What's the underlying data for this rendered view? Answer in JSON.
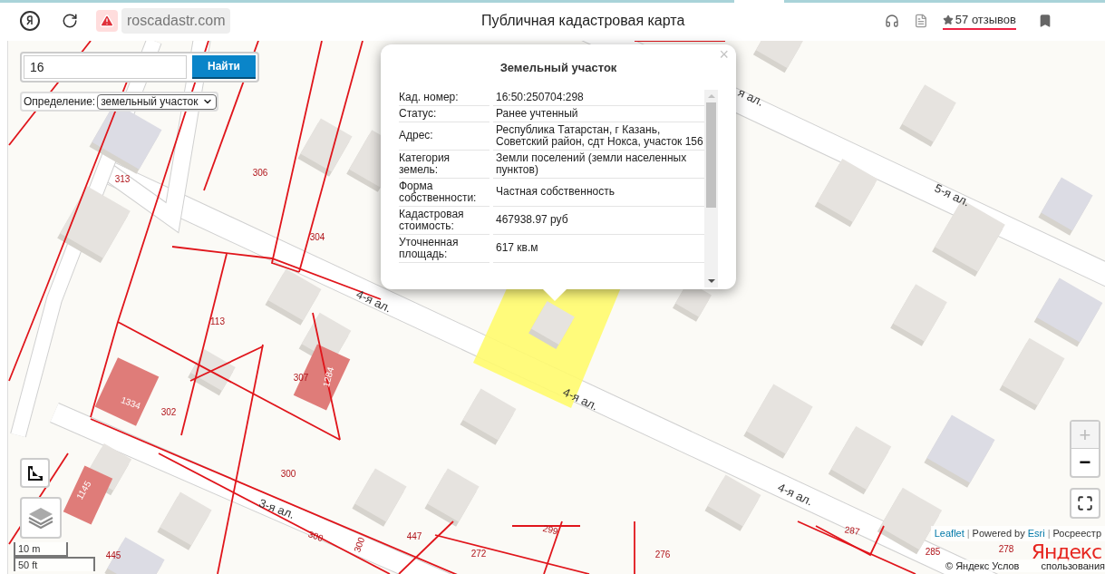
{
  "browser": {
    "address": "roscadastr.com",
    "page_title": "Публичная кадастровая карта",
    "reviews": "57 отзывов"
  },
  "search": {
    "value": "16",
    "button": "Найти"
  },
  "definition": {
    "label": "Определение:",
    "value": "земельный участок"
  },
  "popup": {
    "title": "Земельный участок",
    "close": "×",
    "rows": [
      {
        "label": "Кад. номер:",
        "value": "16:50:250704:298"
      },
      {
        "label": "Статус:",
        "value": "Ранее учтенный"
      },
      {
        "label": "Адрес:",
        "value": "Республика Татарстан, г Казань, Советский район, сдт Нокса, участок 156"
      },
      {
        "label": "Категория земель:",
        "value": "Земли поселений (земли населенных пунктов)"
      },
      {
        "label": "Форма собственности:",
        "value": "Частная собственность"
      },
      {
        "label": "Кадастровая стоимость:",
        "value": "467938.97 руб"
      },
      {
        "label": "Уточненная площадь:",
        "value": "617 кв.м"
      }
    ]
  },
  "map": {
    "street_labels": [
      "я ал.",
      "5-я ал.",
      "4-я ал.",
      "4-я ал.",
      "4-я ал.",
      "3-я ал."
    ],
    "parcel_labels": [
      "313",
      "306",
      "304",
      "113",
      "307",
      "302",
      "300",
      "445",
      "300",
      "300",
      "447",
      "272",
      "299",
      "276",
      "287",
      "285",
      "278"
    ],
    "building_labels": [
      "1284",
      "1334",
      "1145"
    ]
  },
  "zoom": {
    "plus": "+",
    "minus": "−",
    "plus_disabled": true
  },
  "scale": [
    "10 m",
    "50 ft"
  ],
  "attribution": {
    "leaflet": "Leaflet",
    "separators": [
      "|",
      "|"
    ],
    "powered_by": "Powered by",
    "esri": "Esri",
    "source": "Росреестр"
  },
  "yandex_logo": "Яндекс",
  "copyright": [
    "© Яндекс  Услов",
    "спользования"
  ]
}
